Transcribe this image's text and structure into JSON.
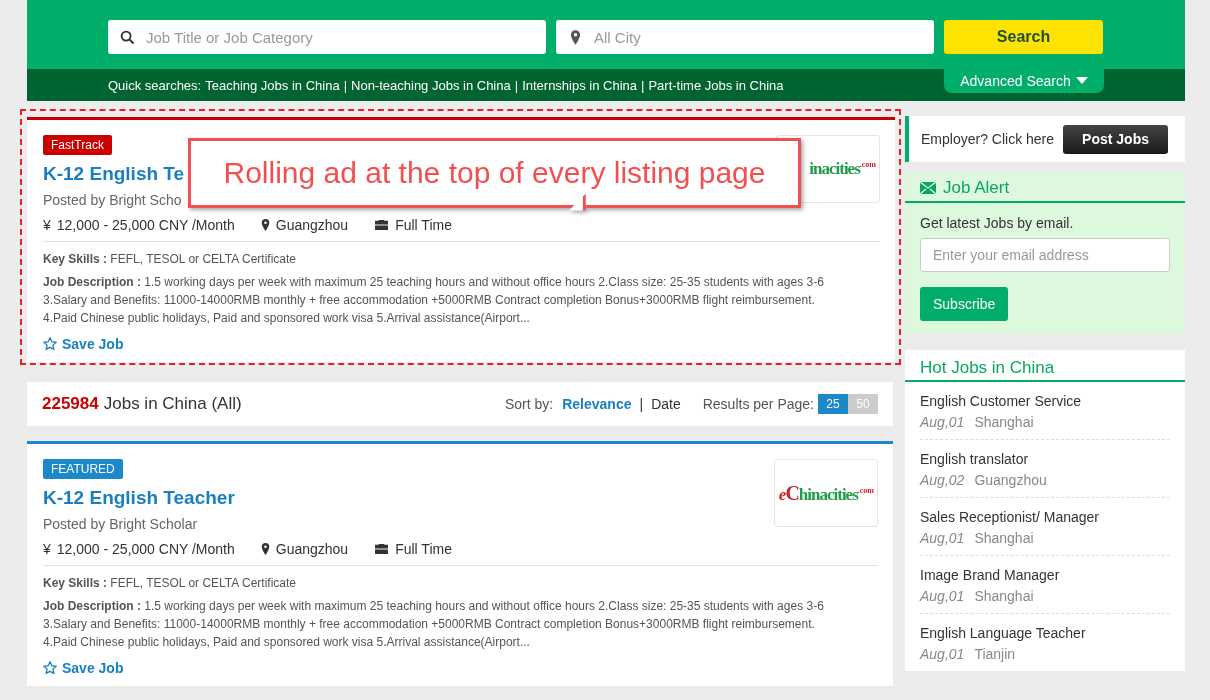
{
  "search": {
    "keyword_placeholder": "Job Title or Job Category",
    "city_placeholder": "All City",
    "button": "Search",
    "advanced": "Advanced Search",
    "quick_label": "Quick searches:",
    "separator": "|",
    "quick_links": [
      "Teaching Jobs in China",
      "Non-teaching Jobs in China",
      "Internships in China",
      "Part-time Jobs in China"
    ]
  },
  "ad": {
    "callout": "Rolling ad at the top of every listing page",
    "card": {
      "kind": "fasttrack",
      "badge": "FastTrack",
      "title": "K-12 English Te",
      "poster": "Posted by Bright Scho",
      "salary": "12,000 - 25,000 CNY /Month",
      "currency": "¥",
      "city": "Guangzhou",
      "type": "Full Time",
      "skills_label": "Key Skills :",
      "skills": "FEFL, TESOL or CELTA Certificate",
      "desc_label": "Job Description :",
      "desc": "1.5 working days per week with maximum 25 teaching hours and without office hours 2.Class size: 25-35 students with ages 3-6 3.Salary and Benefits: 11000-14000RMB monthly + free accommodation +5000RMB Contract completion Bonus+3000RMB flight reimbursement. 4.Paid Chinese public holidays, Paid and sponsored work visa 5.Arrival assistance(Airport...",
      "save": "Save Job",
      "logo": {
        "rest": "inacities",
        "suffix": ".com"
      }
    }
  },
  "results": {
    "count": "225984",
    "label": "Jobs in China (All)",
    "sort_label": "Sort by:",
    "separator": "|",
    "sort_options": [
      {
        "label": "Relevance",
        "selected": true
      },
      {
        "label": "Date",
        "selected": false
      }
    ],
    "per_page_label": "Results per Page:",
    "per_page": [
      {
        "label": "25",
        "selected": true
      },
      {
        "label": "50",
        "selected": false
      }
    ]
  },
  "jobs": [
    {
      "kind": "featured",
      "badge": "FEATURED",
      "title": "K-12 English Teacher",
      "poster": "Posted by Bright Scholar",
      "salary": "12,000 - 25,000 CNY /Month",
      "currency": "¥",
      "city": "Guangzhou",
      "type": "Full Time",
      "skills_label": "Key Skills :",
      "skills": "FEFL, TESOL or CELTA Certificate",
      "desc_label": "Job Description :",
      "desc": "1.5 working days per week with maximum 25 teaching hours and without office hours 2.Class size: 25-35 students with ages 3-6 3.Salary and Benefits: 11000-14000RMB monthly + free accommodation +5000RMB Contract completion Bonus+3000RMB flight reimbursement. 4.Paid Chinese public holidays, Paid and sponsored work visa 5.Arrival assistance(Airport...",
      "save": "Save Job",
      "logo": {
        "prefix": "e",
        "initial": "C",
        "rest": "hinacities",
        "suffix": ".com"
      }
    }
  ],
  "sidebar": {
    "employer_text": "Employer? Click here",
    "post_button": "Post Jobs",
    "alert": {
      "title": "Job Alert",
      "text": "Get latest Jobs by email.",
      "placeholder": "Enter your email address",
      "button": "Subscribe"
    },
    "hot": {
      "title": "Hot Jobs in China",
      "items": [
        {
          "title": "English Customer Service",
          "date": "Aug,01",
          "city": "Shanghai"
        },
        {
          "title": "English translator",
          "date": "Aug,02",
          "city": "Guangzhou"
        },
        {
          "title": "Sales Receptionist/ Manager",
          "date": "Aug,01",
          "city": "Shanghai"
        },
        {
          "title": "Image Brand Manager",
          "date": "Aug,01",
          "city": "Shanghai"
        },
        {
          "title": "English Language Teacher",
          "date": "Aug,01",
          "city": "Tianjin"
        }
      ]
    }
  }
}
